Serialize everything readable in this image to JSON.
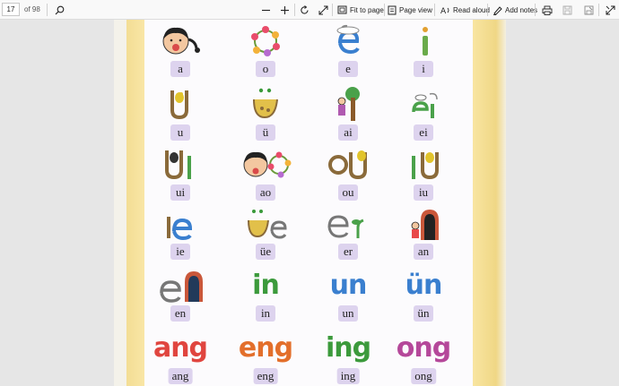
{
  "toolbar": {
    "page_number": "17",
    "page_total": "of 98",
    "fit_to_page": "Fit to page",
    "page_view": "Page view",
    "read_aloud": "Read aloud",
    "add_notes": "Add notes",
    "icons": [
      "search-icon",
      "zoom-out-icon",
      "zoom-in-icon",
      "rotate-icon",
      "fit-to-page-icon",
      "page-view-icon",
      "read-aloud-icon",
      "add-notes-icon",
      "print-icon",
      "save-icon",
      "save-as-icon",
      "fullscreen-icon"
    ]
  },
  "pinyin": {
    "rows": [
      [
        "a",
        "o",
        "e",
        "i"
      ],
      [
        "u",
        "ü",
        "ai",
        "ei"
      ],
      [
        "ui",
        "ao",
        "ou",
        "iu"
      ],
      [
        "ie",
        "üe",
        "er",
        "an"
      ],
      [
        "en",
        "in",
        "un",
        "ün"
      ],
      [
        "ang",
        "eng",
        "ing",
        "ong"
      ]
    ],
    "letter_art": {
      "in": "in",
      "un": "un",
      "ün": "ün",
      "ang": "ang",
      "eng": "eng",
      "ing": "ing",
      "ong": "ong"
    }
  },
  "colors": {
    "book_yellow": "#f3dd94",
    "label_bg": "#ddd3ee",
    "ang": "#e0453f",
    "eng": "#e36f2b",
    "ing": "#3c9a3c",
    "ong": "#b5489a",
    "blue": "#3a7fcf",
    "green": "#4aa14a"
  }
}
